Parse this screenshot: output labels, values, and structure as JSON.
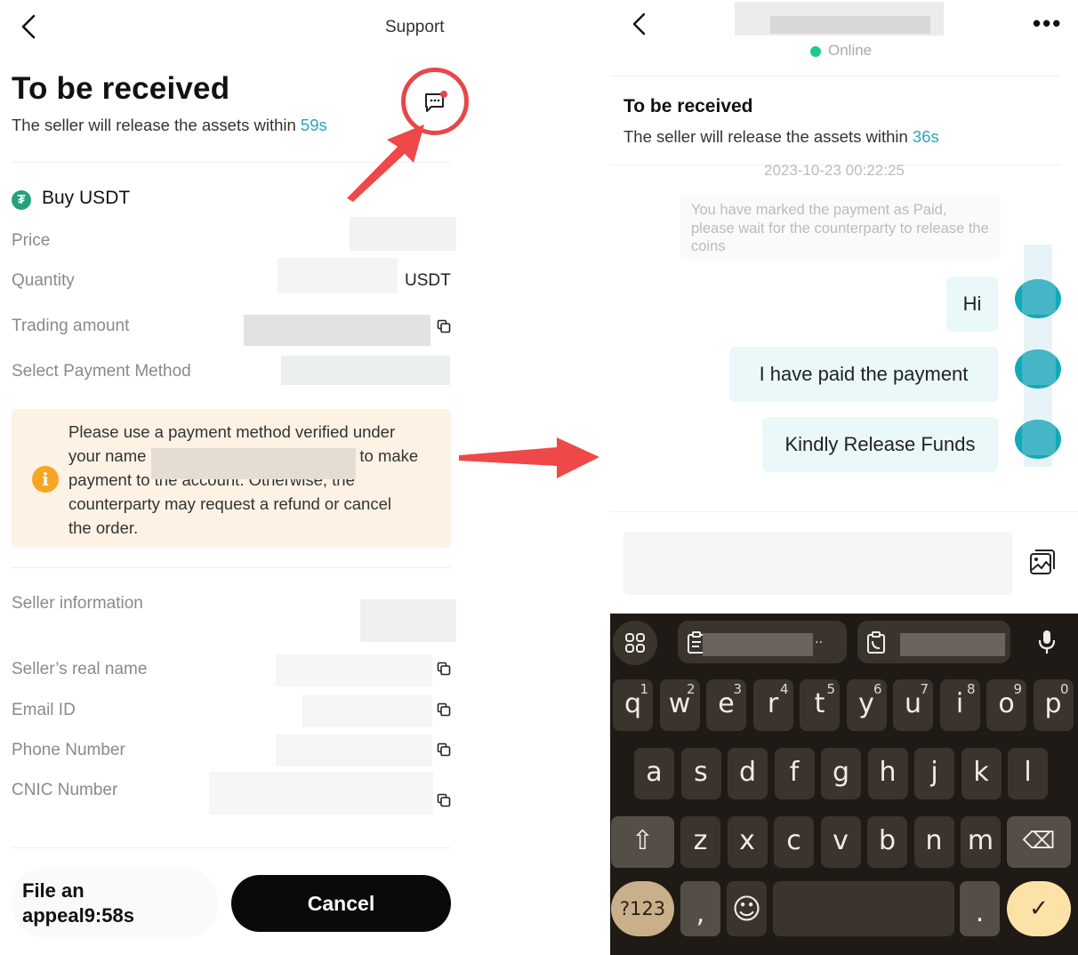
{
  "order_page": {
    "support_label": "Support",
    "title": "To be received",
    "subtitle_prefix": "The seller will release the assets within ",
    "countdown": "59s",
    "asset_title": "Buy USDT",
    "fields": {
      "price_label": "Price",
      "quantity_label": "Quantity",
      "quantity_unit": "USDT",
      "trading_amount_label": "Trading amount",
      "payment_method_label": "Select Payment Method"
    },
    "warning": {
      "line1": "Please use a payment method verified under",
      "line2_prefix": "your name",
      "line2_suffix": "to make",
      "line3": "payment to the account. Otherwise, the",
      "line4": "counterparty may request a refund or cancel",
      "line5": "the order."
    },
    "seller_info": {
      "heading": "Seller information",
      "real_name_label": "Seller’s real name",
      "email_label": "Email ID",
      "phone_label": "Phone Number",
      "cnic_label": "CNIC Number"
    },
    "appeal_label": "File an appeal9:58s",
    "cancel_label": "Cancel"
  },
  "chat_page": {
    "status": "Online",
    "title": "To be received",
    "subtitle_prefix": "The seller will release the assets within ",
    "countdown": "36s",
    "timestamp": "2023-10-23 00:22:25",
    "system_message": "You have marked the payment as Paid, please wait for the counterparty to release the coins",
    "messages": [
      {
        "text": "Hi",
        "from": "me"
      },
      {
        "text": "I have paid the payment",
        "from": "me"
      },
      {
        "text": "Kindly Release Funds",
        "from": "me"
      }
    ],
    "input_placeholder": ""
  },
  "keyboard": {
    "row1": [
      {
        "k": "q",
        "n": "1"
      },
      {
        "k": "w",
        "n": "2"
      },
      {
        "k": "e",
        "n": "3"
      },
      {
        "k": "r",
        "n": "4"
      },
      {
        "k": "t",
        "n": "5"
      },
      {
        "k": "y",
        "n": "6"
      },
      {
        "k": "u",
        "n": "7"
      },
      {
        "k": "i",
        "n": "8"
      },
      {
        "k": "o",
        "n": "9"
      },
      {
        "k": "p",
        "n": "0"
      }
    ],
    "row2": [
      "a",
      "s",
      "d",
      "f",
      "g",
      "h",
      "j",
      "k",
      "l"
    ],
    "row3": [
      "z",
      "x",
      "c",
      "v",
      "b",
      "n",
      "m"
    ],
    "symbols_label": "?123",
    "comma": ",",
    "period": ".",
    "emoji": "☺",
    "shift": "⇧",
    "enter": "✓"
  },
  "colors": {
    "accent_teal": "#2aa6bf",
    "annotation_red": "#e8474a",
    "online_green": "#1fc88b",
    "warning_bg": "#fdf2e4",
    "tether_green": "#26a17b"
  }
}
